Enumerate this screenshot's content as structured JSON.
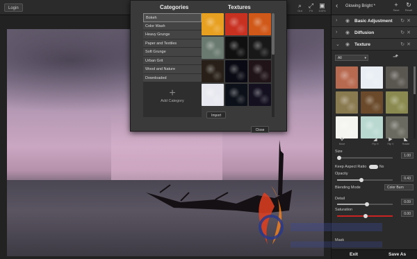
{
  "toolbar": {
    "login_label": "Login",
    "tools": [
      {
        "icon": "zoom-out-icon",
        "label": "Out"
      },
      {
        "icon": "fit-icon",
        "label": "Fit"
      },
      {
        "icon": "fullscreen-icon",
        "label": "100%"
      }
    ]
  },
  "dialog": {
    "categories_header": "Categories",
    "textures_header": "Textures",
    "categories": [
      "Bokeh",
      "Color Wash",
      "Heavy Grunge",
      "Paper and Textiles",
      "Soft Grunge",
      "Urban Grit",
      "Wood and Nature",
      "Downloaded"
    ],
    "selected_category": "Bokeh",
    "add_category_label": "Add Category",
    "import_label": "Import",
    "close_label": "Close",
    "texture_colors": [
      "#e8a020",
      "#c83020",
      "#d05818",
      "#6a7a70",
      "#101010",
      "#181818",
      "#282018",
      "#0a0a14",
      "#201418",
      "#e8e8f0",
      "#0c1018",
      "#141020"
    ]
  },
  "panel": {
    "title": "Glowing Bright *",
    "save_label": "Save",
    "reset_label": "Reset",
    "layers": [
      {
        "name": "Basic Adjustment"
      },
      {
        "name": "Diffusion"
      },
      {
        "name": "Texture"
      }
    ],
    "texture_filter": "All",
    "texture_colors": [
      "#b86a50",
      "#e8eef4",
      "#5a5650",
      "#8a7a50",
      "#6a4a2a",
      "#8a8a50",
      "#f4f4f0",
      "#b8d8d0",
      "#6a6a60"
    ],
    "flip_tools": [
      {
        "icon": "move-icon",
        "label": "Move"
      },
      {
        "icon": "flip-h-icon",
        "label": "Flip H"
      },
      {
        "icon": "flip-v-icon",
        "label": "Flip V"
      },
      {
        "icon": "rotate-icon",
        "label": "Rotate"
      }
    ],
    "size_label": "Size",
    "size_value": "1.00",
    "keep_aspect_label": "Keep Aspect Ratio",
    "keep_aspect_toggle": "No",
    "opacity_label": "Opacity",
    "opacity_value": "0.43",
    "blending_label": "Blending Mode",
    "blending_value": "Color Burn",
    "detail_label": "Detail",
    "detail_value": "0.09",
    "saturation_label": "Saturation",
    "saturation_value": "0.00",
    "mask_label": "Mask",
    "exit_label": "Exit",
    "save_as_label": "Save As"
  },
  "colors": {
    "accent": "#cc2222",
    "panel_bg": "#2b2b2b"
  }
}
